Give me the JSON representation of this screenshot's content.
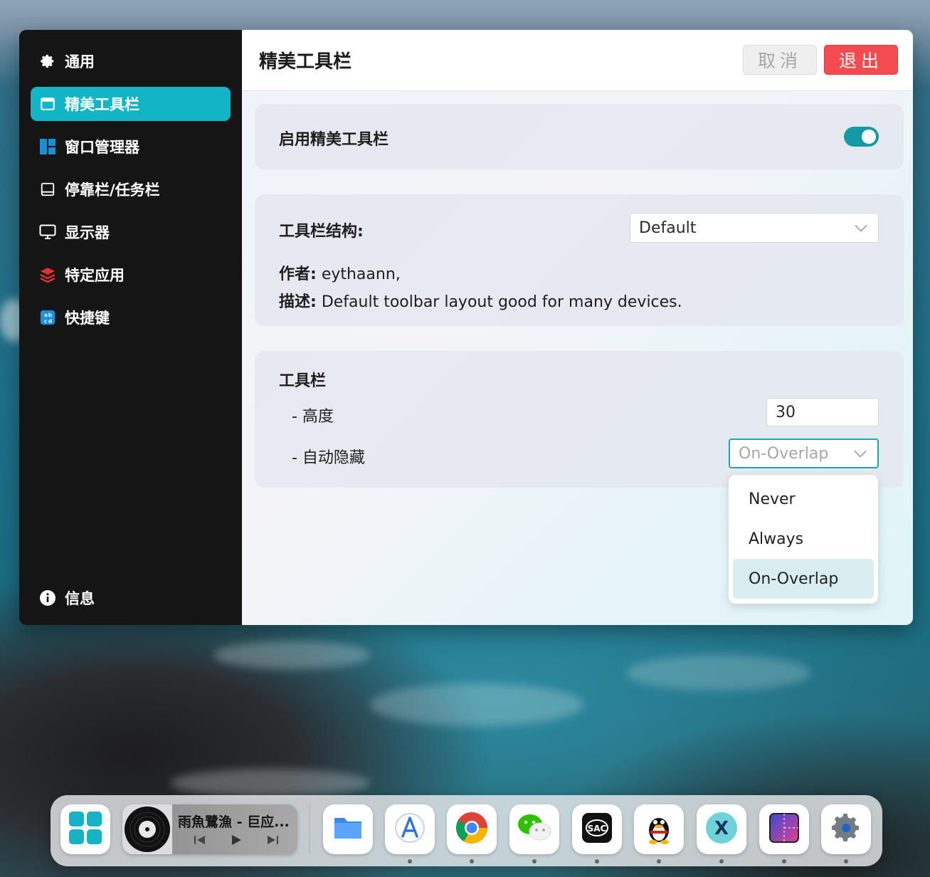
{
  "sidebar": {
    "items": [
      {
        "label": "通用"
      },
      {
        "label": "精美工具栏"
      },
      {
        "label": "窗口管理器"
      },
      {
        "label": "停靠栏/任务栏"
      },
      {
        "label": "显示器"
      },
      {
        "label": "特定应用"
      },
      {
        "label": "快捷键"
      }
    ],
    "info_label": "信息"
  },
  "header": {
    "title": "精美工具栏",
    "cancel_label": "取消",
    "exit_label": "退出"
  },
  "enable_card": {
    "label": "启用精美工具栏",
    "enabled": true
  },
  "structure_card": {
    "label": "工具栏结构:",
    "selected": "Default",
    "author_label": "作者:",
    "author_value": "eythaann,",
    "desc_label": "描述:",
    "desc_value": "Default toolbar layout good for many devices."
  },
  "toolbar_card": {
    "title": "工具栏",
    "height_label": "- 高度",
    "height_value": "30",
    "autohide_label": "- 自动隐藏",
    "autohide_value": "On-Overlap",
    "autohide_options": [
      "Never",
      "Always",
      "On-Overlap"
    ]
  },
  "dock": {
    "media_title": "雨魚鷺漁 - 巨应...",
    "apps": [
      "app-grid",
      "files",
      "app-store",
      "chrome",
      "wechat",
      "sac",
      "qq",
      "x-app",
      "snipping",
      "settings"
    ]
  },
  "colors": {
    "accent": "#12b5c6",
    "exit": "#f34b4f",
    "sidebar_bg": "#151515"
  }
}
